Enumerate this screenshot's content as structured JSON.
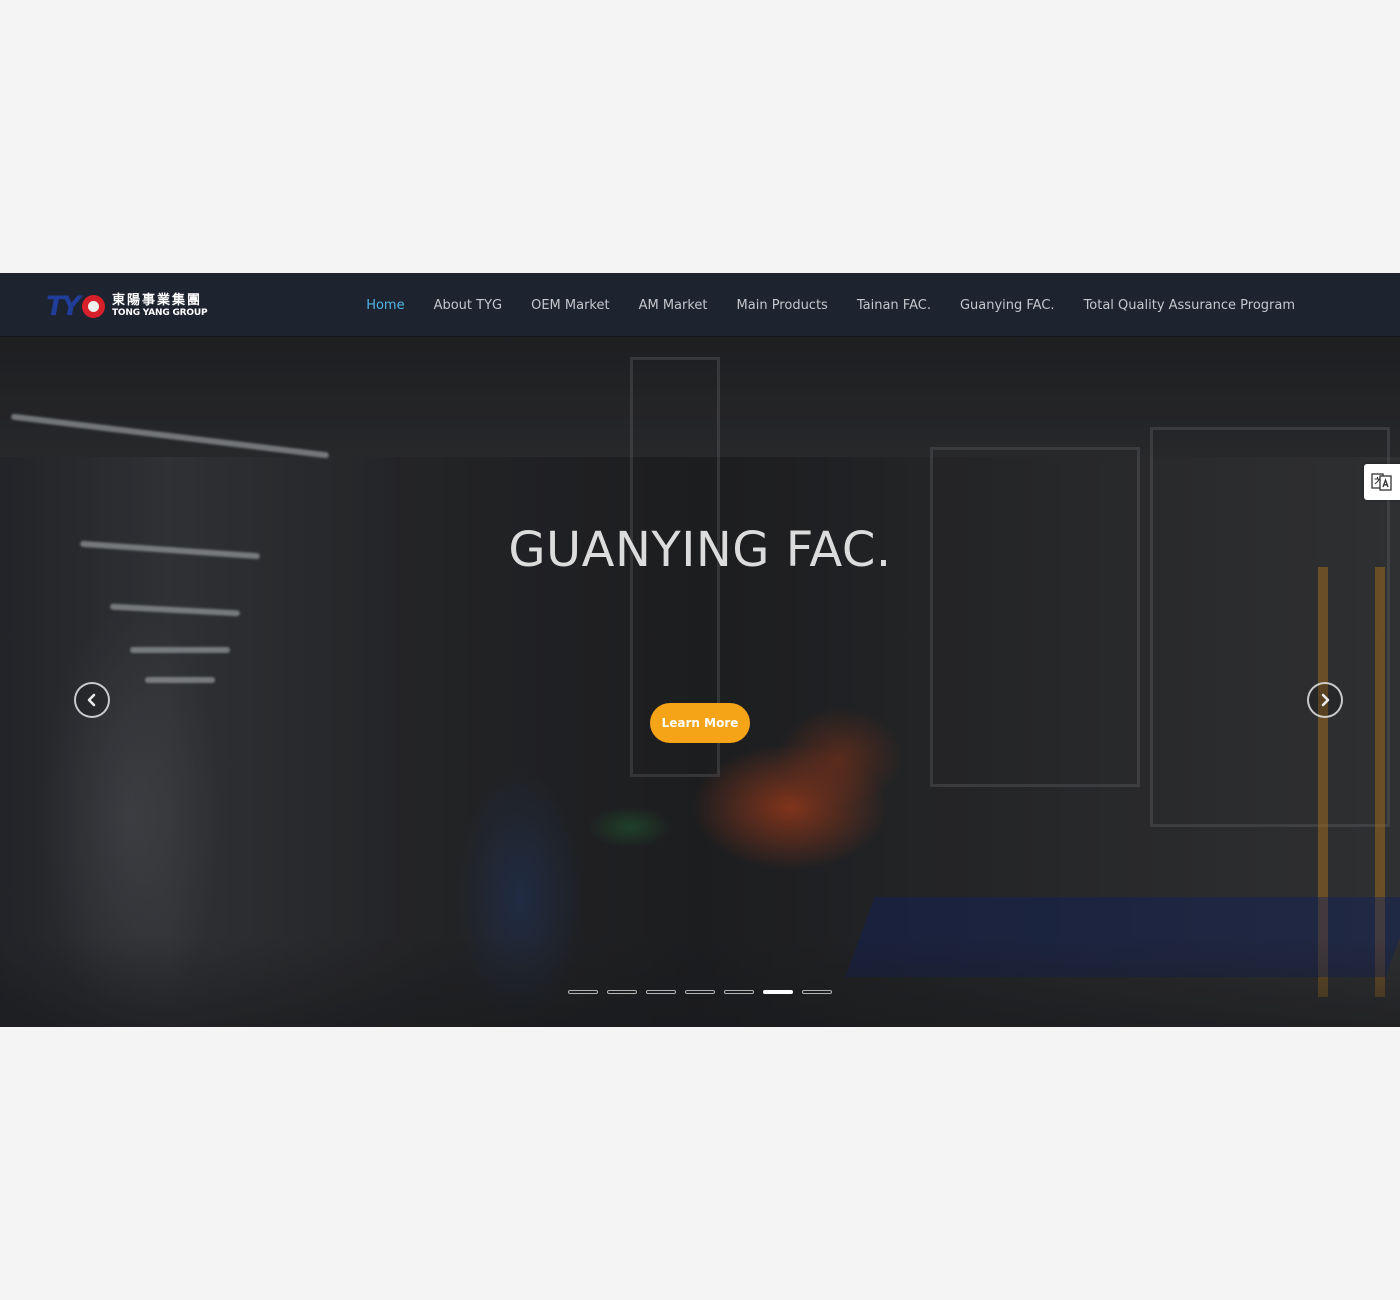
{
  "brand": {
    "mark": "TY",
    "chinese_name": "東陽事業集團",
    "english_name": "TONG YANG GROUP",
    "colors": {
      "mark_blue": "#203d9a",
      "mark_red": "#d7202a"
    }
  },
  "nav": {
    "items": [
      {
        "label": "Home",
        "active": true
      },
      {
        "label": "About TYG",
        "active": false
      },
      {
        "label": "OEM Market",
        "active": false
      },
      {
        "label": "AM Market",
        "active": false
      },
      {
        "label": "Main Products",
        "active": false
      },
      {
        "label": "Tainan FAC.",
        "active": false
      },
      {
        "label": "Guanying FAC.",
        "active": false
      },
      {
        "label": "Total Quality Assurance Program",
        "active": false
      }
    ],
    "active_color": "#4fb6e8"
  },
  "hero": {
    "title": "GUANYING FAC.",
    "cta_label": "Learn More",
    "cta_color": "#f5a417",
    "prev_icon": "chevron-left-icon",
    "next_icon": "chevron-right-icon",
    "slides_total": 7,
    "active_slide": 6
  },
  "widgets": {
    "translate_icon": "translate-icon"
  }
}
